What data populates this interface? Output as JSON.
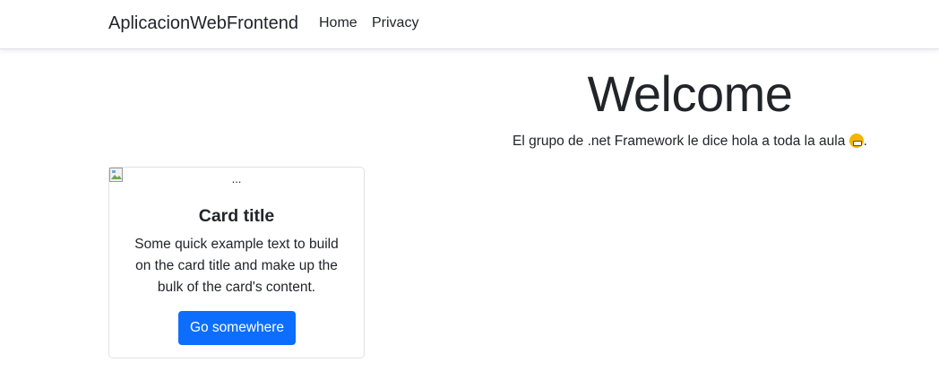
{
  "navbar": {
    "brand": "AplicacionWebFrontend",
    "links": [
      {
        "label": "Home"
      },
      {
        "label": "Privacy"
      }
    ]
  },
  "main": {
    "title": "Welcome",
    "lead": "El grupo de .net Framework le dice hola a toda la aula",
    "lead_suffix": ".",
    "emoji_icon": "grimacing-face-icon"
  },
  "card": {
    "image_alt": "...",
    "title": "Card title",
    "text": "Some quick example text to build on the card title and make up the bulk of the card's content.",
    "button_label": "Go somewhere"
  },
  "colors": {
    "primary": "#0d6efd",
    "text": "#212529",
    "border": "#dee2e6"
  }
}
